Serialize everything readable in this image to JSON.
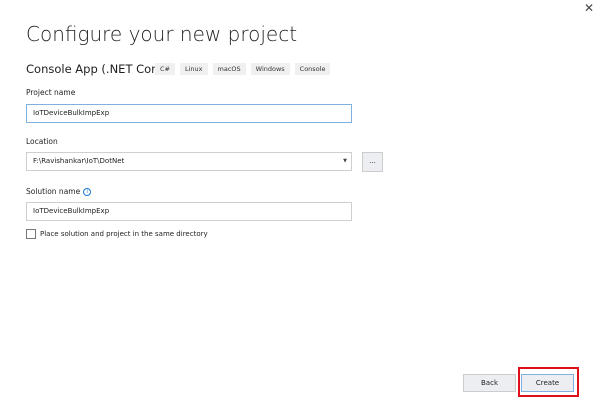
{
  "window": {
    "close_icon": "close-icon"
  },
  "title": "Configure your new project",
  "template": {
    "name": "Console App (.NET Core)",
    "tags": [
      "C#",
      "Linux",
      "macOS",
      "Windows",
      "Console"
    ]
  },
  "project_name": {
    "label": "Project name",
    "value": "IoTDeviceBulkImpExp"
  },
  "location": {
    "label": "Location",
    "value": "F:\\Ravishankar\\IoT\\DotNet",
    "browse_label": "..."
  },
  "solution_name": {
    "label": "Solution name",
    "value": "IoTDeviceBulkImpExp",
    "info": "i"
  },
  "same_directory": {
    "label": "Place solution and project in the same directory",
    "checked": false
  },
  "buttons": {
    "back": "Back",
    "create": "Create"
  },
  "colors": {
    "highlight": "#e0101a",
    "focus": "#7fb0e0"
  }
}
